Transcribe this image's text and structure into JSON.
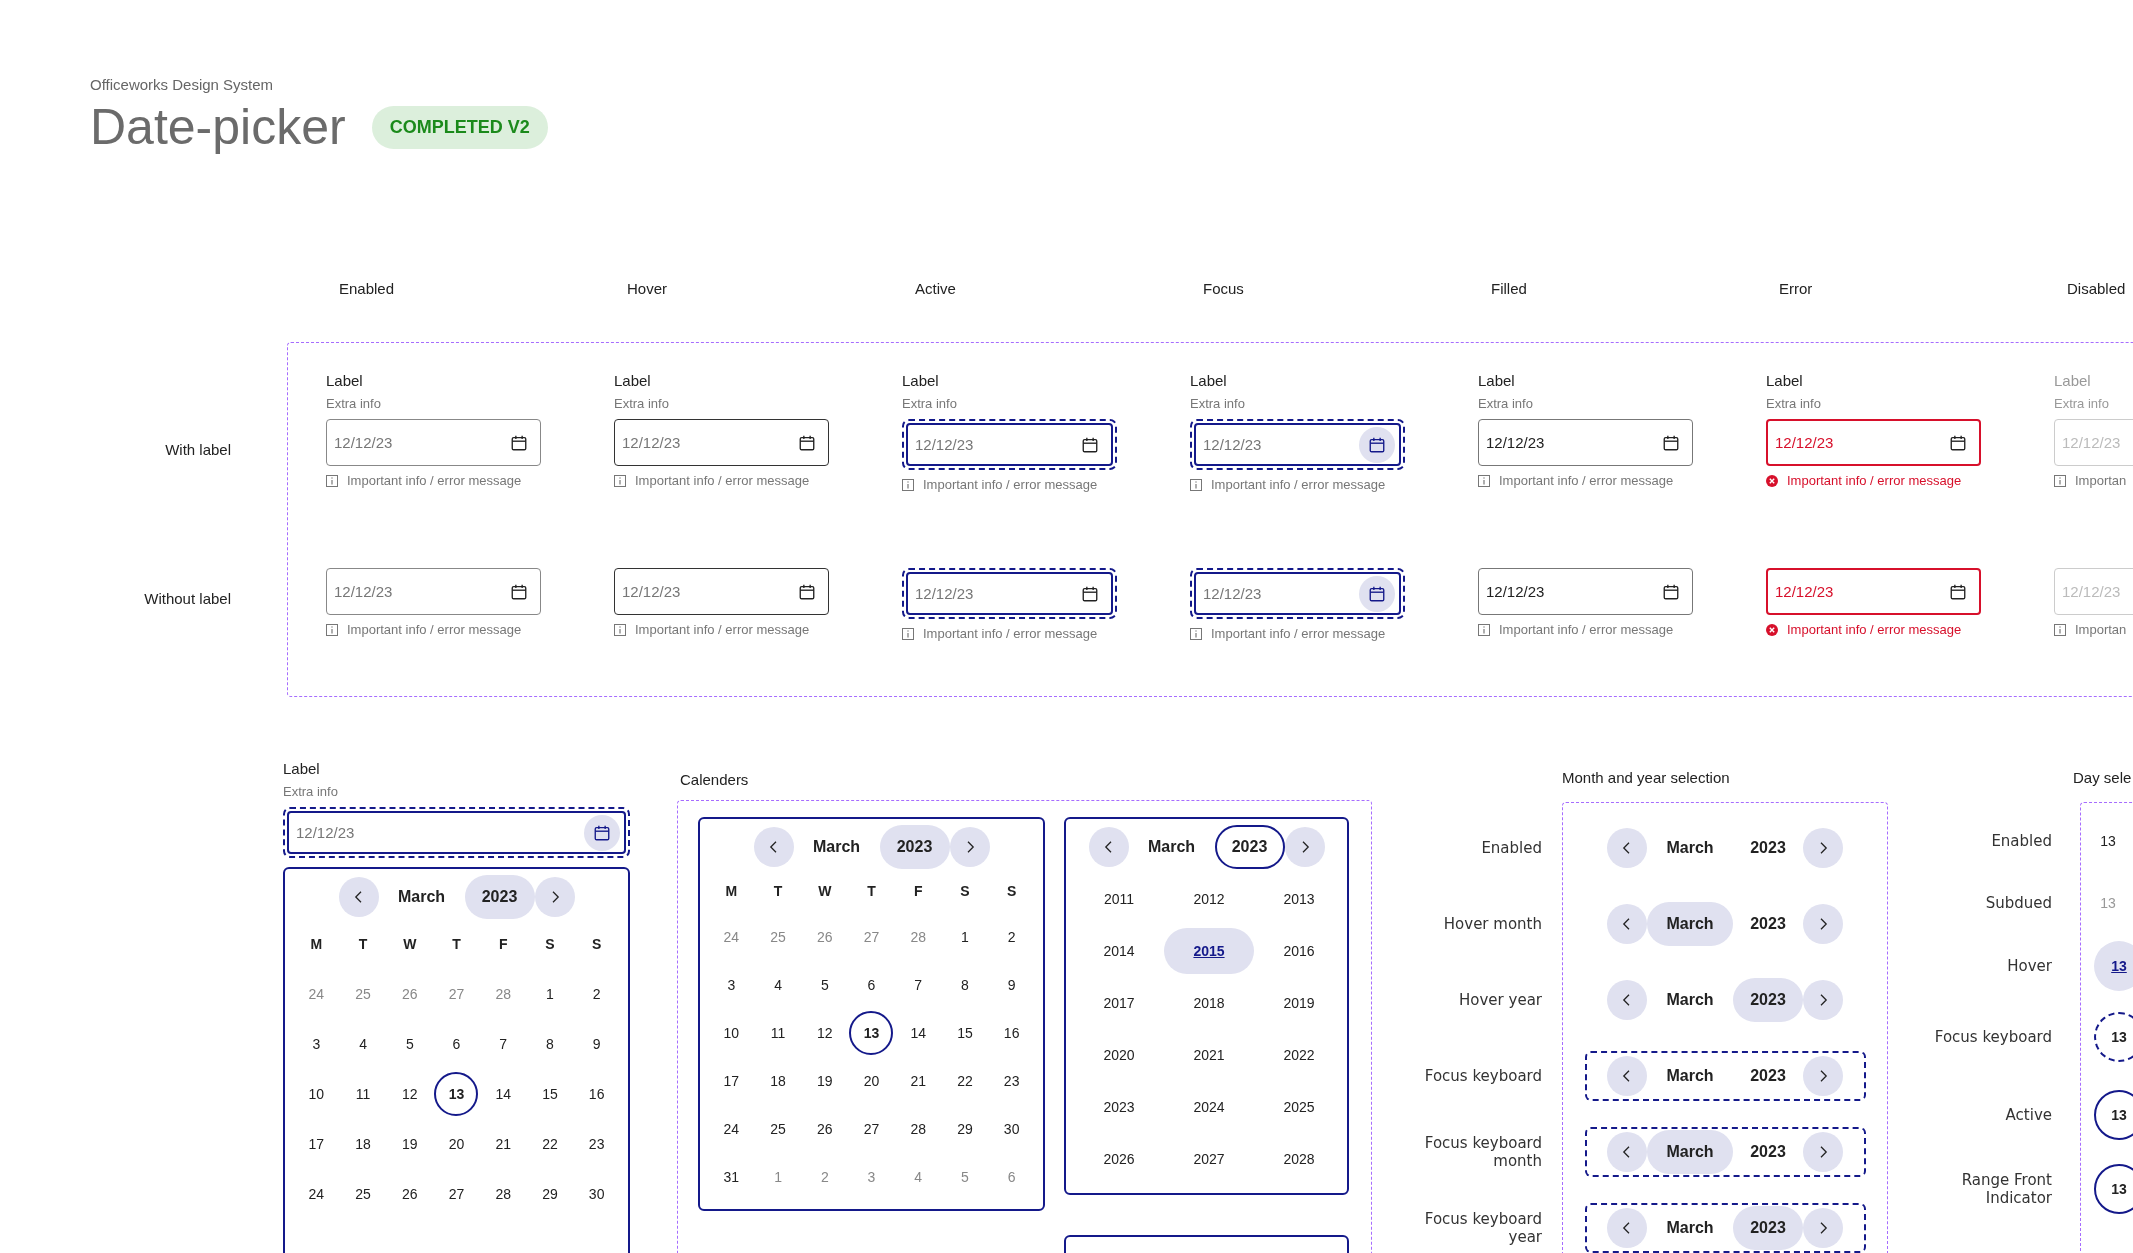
{
  "header": {
    "subtitle": "Officeworks Design System",
    "title": "Date-picker",
    "badge": "COMPLETED V2"
  },
  "states": {
    "row_labels": [
      "With label",
      "Without label"
    ],
    "columns": [
      {
        "heading": "Enabled",
        "kind": "enabled",
        "with_label": {
          "label": "Label",
          "extra": "Extra info",
          "placeholder": "12/12/23",
          "message": "Important info / error message"
        },
        "without_label": {
          "placeholder": "12/12/23",
          "message": "Important info / error message"
        }
      },
      {
        "heading": "Hover",
        "kind": "hover",
        "with_label": {
          "label": "Label",
          "extra": "Extra info",
          "placeholder": "12/12/23",
          "message": "Important info / error message"
        },
        "without_label": {
          "placeholder": "12/12/23",
          "message": "Important info / error message"
        }
      },
      {
        "heading": "Active",
        "kind": "active",
        "with_label": {
          "label": "Label",
          "extra": "Extra info",
          "placeholder": "12/12/23",
          "message": "Important info / error message"
        },
        "without_label": {
          "placeholder": "12/12/23",
          "message": "Important info / error message"
        }
      },
      {
        "heading": "Focus",
        "kind": "focus",
        "with_label": {
          "label": "Label",
          "extra": "Extra info",
          "placeholder": "12/12/23",
          "message": "Important info / error message"
        },
        "without_label": {
          "placeholder": "12/12/23",
          "message": "Important info / error message"
        }
      },
      {
        "heading": "Filled",
        "kind": "filled",
        "with_label": {
          "label": "Label",
          "extra": "Extra info",
          "value": "12/12/23",
          "message": "Important info / error message"
        },
        "without_label": {
          "value": "12/12/23",
          "message": "Important info / error message"
        }
      },
      {
        "heading": "Error",
        "kind": "error",
        "with_label": {
          "label": "Label",
          "extra": "Extra info",
          "value": "12/12/23",
          "message": "Important info / error message"
        },
        "without_label": {
          "value": "12/12/23",
          "message": "Important info / error message"
        }
      },
      {
        "heading": "Disabled",
        "kind": "disabled",
        "with_label": {
          "label": "Label",
          "extra": "Extra info",
          "placeholder": "12/12/23",
          "message": "Importan"
        },
        "without_label": {
          "placeholder": "12/12/23",
          "message": "Importan"
        }
      }
    ]
  },
  "open_picker": {
    "label": "Label",
    "extra": "Extra info",
    "placeholder": "12/12/23",
    "calendar": {
      "month": "March",
      "year": "2023",
      "year_hover": true,
      "year_open": false,
      "weekdays": [
        "M",
        "T",
        "W",
        "T",
        "F",
        "S",
        "S"
      ],
      "weeks": [
        [
          {
            "day": "24",
            "muted": true,
            "selected": false
          },
          {
            "day": "25",
            "muted": true,
            "selected": false
          },
          {
            "day": "26",
            "muted": true,
            "selected": false
          },
          {
            "day": "27",
            "muted": true,
            "selected": false
          },
          {
            "day": "28",
            "muted": true,
            "selected": false
          },
          {
            "day": "1",
            "muted": false,
            "selected": false
          },
          {
            "day": "2",
            "muted": false,
            "selected": false
          }
        ],
        [
          {
            "day": "3",
            "muted": false,
            "selected": false
          },
          {
            "day": "4",
            "muted": false,
            "selected": false
          },
          {
            "day": "5",
            "muted": false,
            "selected": false
          },
          {
            "day": "6",
            "muted": false,
            "selected": false
          },
          {
            "day": "7",
            "muted": false,
            "selected": false
          },
          {
            "day": "8",
            "muted": false,
            "selected": false
          },
          {
            "day": "9",
            "muted": false,
            "selected": false
          }
        ],
        [
          {
            "day": "10",
            "muted": false,
            "selected": false
          },
          {
            "day": "11",
            "muted": false,
            "selected": false
          },
          {
            "day": "12",
            "muted": false,
            "selected": false
          },
          {
            "day": "13",
            "muted": false,
            "selected": true
          },
          {
            "day": "14",
            "muted": false,
            "selected": false
          },
          {
            "day": "15",
            "muted": false,
            "selected": false
          },
          {
            "day": "16",
            "muted": false,
            "selected": false
          }
        ],
        [
          {
            "day": "17",
            "muted": false,
            "selected": false
          },
          {
            "day": "18",
            "muted": false,
            "selected": false
          },
          {
            "day": "19",
            "muted": false,
            "selected": false
          },
          {
            "day": "20",
            "muted": false,
            "selected": false
          },
          {
            "day": "21",
            "muted": false,
            "selected": false
          },
          {
            "day": "22",
            "muted": false,
            "selected": false
          },
          {
            "day": "23",
            "muted": false,
            "selected": false
          }
        ],
        [
          {
            "day": "24",
            "muted": false,
            "selected": false
          },
          {
            "day": "25",
            "muted": false,
            "selected": false
          },
          {
            "day": "26",
            "muted": false,
            "selected": false
          },
          {
            "day": "27",
            "muted": false,
            "selected": false
          },
          {
            "day": "28",
            "muted": false,
            "selected": false
          },
          {
            "day": "29",
            "muted": false,
            "selected": false
          },
          {
            "day": "30",
            "muted": false,
            "selected": false
          }
        ]
      ]
    }
  },
  "calendars": {
    "title": "Calenders",
    "day_view": {
      "month": "March",
      "year": "2023",
      "year_hover": true,
      "year_open": false,
      "weekdays": [
        "M",
        "T",
        "W",
        "T",
        "F",
        "S",
        "S"
      ],
      "weeks": [
        [
          {
            "day": "24",
            "muted": true,
            "selected": false
          },
          {
            "day": "25",
            "muted": true,
            "selected": false
          },
          {
            "day": "26",
            "muted": true,
            "selected": false
          },
          {
            "day": "27",
            "muted": true,
            "selected": false
          },
          {
            "day": "28",
            "muted": true,
            "selected": false
          },
          {
            "day": "1",
            "muted": false,
            "selected": false
          },
          {
            "day": "2",
            "muted": false,
            "selected": false
          }
        ],
        [
          {
            "day": "3",
            "muted": false,
            "selected": false
          },
          {
            "day": "4",
            "muted": false,
            "selected": false
          },
          {
            "day": "5",
            "muted": false,
            "selected": false
          },
          {
            "day": "6",
            "muted": false,
            "selected": false
          },
          {
            "day": "7",
            "muted": false,
            "selected": false
          },
          {
            "day": "8",
            "muted": false,
            "selected": false
          },
          {
            "day": "9",
            "muted": false,
            "selected": false
          }
        ],
        [
          {
            "day": "10",
            "muted": false,
            "selected": false
          },
          {
            "day": "11",
            "muted": false,
            "selected": false
          },
          {
            "day": "12",
            "muted": false,
            "selected": false
          },
          {
            "day": "13",
            "muted": false,
            "selected": true
          },
          {
            "day": "14",
            "muted": false,
            "selected": false
          },
          {
            "day": "15",
            "muted": false,
            "selected": false
          },
          {
            "day": "16",
            "muted": false,
            "selected": false
          }
        ],
        [
          {
            "day": "17",
            "muted": false,
            "selected": false
          },
          {
            "day": "18",
            "muted": false,
            "selected": false
          },
          {
            "day": "19",
            "muted": false,
            "selected": false
          },
          {
            "day": "20",
            "muted": false,
            "selected": false
          },
          {
            "day": "21",
            "muted": false,
            "selected": false
          },
          {
            "day": "22",
            "muted": false,
            "selected": false
          },
          {
            "day": "23",
            "muted": false,
            "selected": false
          }
        ],
        [
          {
            "day": "24",
            "muted": false,
            "selected": false
          },
          {
            "day": "25",
            "muted": false,
            "selected": false
          },
          {
            "day": "26",
            "muted": false,
            "selected": false
          },
          {
            "day": "27",
            "muted": false,
            "selected": false
          },
          {
            "day": "28",
            "muted": false,
            "selected": false
          },
          {
            "day": "29",
            "muted": false,
            "selected": false
          },
          {
            "day": "30",
            "muted": false,
            "selected": false
          }
        ],
        [
          {
            "day": "31",
            "muted": false,
            "selected": false
          },
          {
            "day": "1",
            "muted": true,
            "selected": false
          },
          {
            "day": "2",
            "muted": true,
            "selected": false
          },
          {
            "day": "3",
            "muted": true,
            "selected": false
          },
          {
            "day": "4",
            "muted": true,
            "selected": false
          },
          {
            "day": "5",
            "muted": true,
            "selected": false
          },
          {
            "day": "6",
            "muted": true,
            "selected": false
          }
        ]
      ]
    },
    "year_view": {
      "month": "March",
      "year": "2023",
      "year_hover": false,
      "year_open": true,
      "years": [
        {
          "year": "2011",
          "selected": false
        },
        {
          "year": "2012",
          "selected": false
        },
        {
          "year": "2013",
          "selected": false
        },
        {
          "year": "2014",
          "selected": false
        },
        {
          "year": "2015",
          "selected": true
        },
        {
          "year": "2016",
          "selected": false
        },
        {
          "year": "2017",
          "selected": false
        },
        {
          "year": "2018",
          "selected": false
        },
        {
          "year": "2019",
          "selected": false
        },
        {
          "year": "2020",
          "selected": false
        },
        {
          "year": "2021",
          "selected": false
        },
        {
          "year": "2022",
          "selected": false
        },
        {
          "year": "2023",
          "selected": false
        },
        {
          "year": "2024",
          "selected": false
        },
        {
          "year": "2025",
          "selected": false
        },
        {
          "year": "2026",
          "selected": false
        },
        {
          "year": "2027",
          "selected": false
        },
        {
          "year": "2028",
          "selected": false
        }
      ]
    }
  },
  "month_year_selection": {
    "title": "Month and year selection",
    "rows": [
      {
        "label": "Enabled",
        "kind": "enabled",
        "month": "March",
        "year": "2023"
      },
      {
        "label": "Hover month",
        "kind": "hover-month",
        "month": "March",
        "year": "2023"
      },
      {
        "label": "Hover year",
        "kind": "hover-year",
        "month": "March",
        "year": "2023"
      },
      {
        "label": "Focus keyboard",
        "kind": "focus",
        "month": "March",
        "year": "2023"
      },
      {
        "label": "Focus keyboard month",
        "kind": "focus-month",
        "month": "March",
        "year": "2023"
      },
      {
        "label": "Focus keyboard year",
        "kind": "focus-year",
        "month": "March",
        "year": "2023"
      }
    ]
  },
  "day_selection": {
    "title": "Day sele",
    "rows": [
      {
        "label": "Enabled",
        "kind": "enabled",
        "day": "13"
      },
      {
        "label": "Subdued",
        "kind": "subdued",
        "day": "13"
      },
      {
        "label": "Hover",
        "kind": "hover",
        "day": "13"
      },
      {
        "label": "Focus keyboard",
        "kind": "focus",
        "day": "13"
      },
      {
        "label": "Active",
        "kind": "active",
        "day": "13"
      },
      {
        "label": "Range Front Indicator",
        "kind": "range-front",
        "day": "13"
      }
    ]
  }
}
